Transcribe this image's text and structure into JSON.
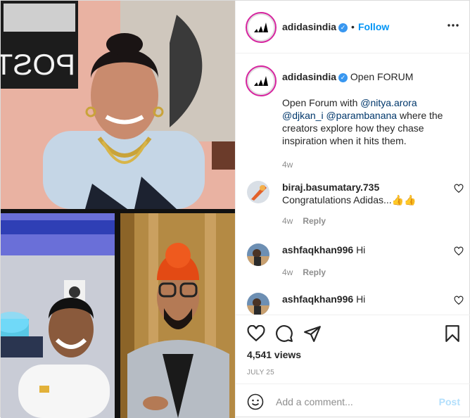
{
  "header": {
    "username": "adidasindia",
    "follow_label": "Follow",
    "more_icon": "more-icon"
  },
  "caption": {
    "username": "adidasindia",
    "title": "Open FORUM",
    "text_prefix": "Open Forum with ",
    "mention1": "@nitya.arora",
    "mention2": "@djkan_i",
    "mention3": "@parambanana",
    "text_suffix": " where the creators explore how they chase inspiration when it hits them.",
    "time": "4w"
  },
  "comments": [
    {
      "username": "biraj.basumatary.735",
      "text": "Congratulations Adidas...👍👍",
      "time": "4w",
      "reply_label": "Reply"
    },
    {
      "username": "ashfaqkhan996",
      "text": "Hi",
      "time": "4w",
      "reply_label": "Reply"
    },
    {
      "username": "ashfaqkhan996",
      "text": "Hi"
    }
  ],
  "stats": {
    "views": "4,541 views",
    "date": "JULY 25"
  },
  "add_comment": {
    "placeholder": "Add a comment...",
    "post_label": "Post"
  },
  "colors": {
    "link_blue": "#0095f6",
    "mention_blue": "#00376b",
    "muted": "#8e8e8e"
  }
}
